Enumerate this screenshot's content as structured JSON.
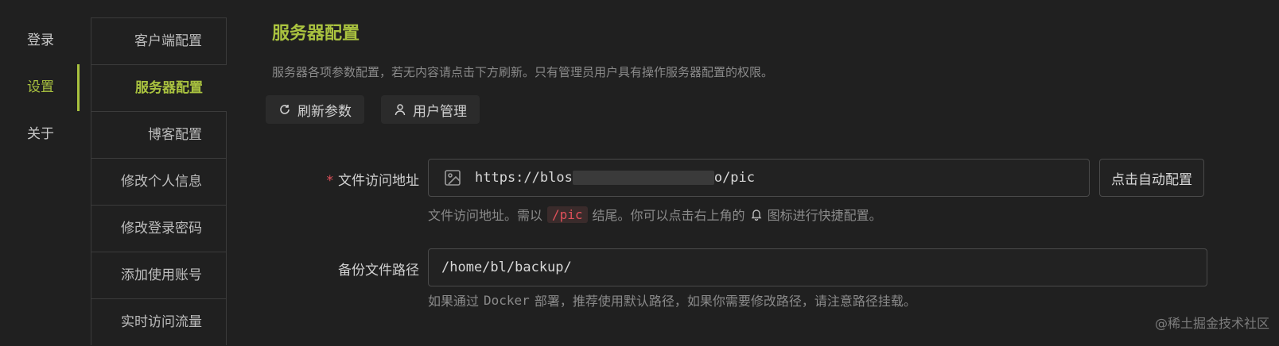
{
  "left_nav": {
    "items": [
      {
        "label": "登录"
      },
      {
        "label": "设置"
      },
      {
        "label": "关于"
      }
    ]
  },
  "sub_nav": {
    "items": [
      {
        "label": "客户端配置"
      },
      {
        "label": "服务器配置"
      },
      {
        "label": "博客配置"
      },
      {
        "label": "修改个人信息"
      },
      {
        "label": "修改登录密码"
      },
      {
        "label": "添加使用账号"
      },
      {
        "label": "实时访问流量"
      }
    ]
  },
  "main": {
    "title": "服务器配置",
    "description": "服务器各项参数配置，若无内容请点击下方刷新。只有管理员用户具有操作服务器配置的权限。",
    "refresh_label": "刷新参数",
    "user_mgmt_label": "用户管理",
    "file_url": {
      "required_mark": "*",
      "label": "文件访问地址",
      "value_prefix": "https://blos",
      "value_suffix": "o/pic",
      "auto_config_label": "点击自动配置",
      "hint_before": "文件访问地址。需以",
      "hint_code": "/pic",
      "hint_middle": "结尾。你可以点击右上角的",
      "hint_after": "图标进行快捷配置。"
    },
    "backup_path": {
      "label": "备份文件路径",
      "value": "/home/bl/backup/",
      "hint_before": "如果通过",
      "hint_mono": "Docker",
      "hint_after": "部署，推荐使用默认路径，如果你需要修改路径，请注意路径挂载。"
    }
  },
  "watermark": "@稀土掘金技术社区",
  "colors": {
    "accent": "#a9c23f",
    "required": "#e0505a",
    "background": "#202020"
  },
  "icons": {
    "refresh": "refresh-icon",
    "user": "user-icon",
    "image": "image-icon",
    "bell": "bell-icon"
  }
}
